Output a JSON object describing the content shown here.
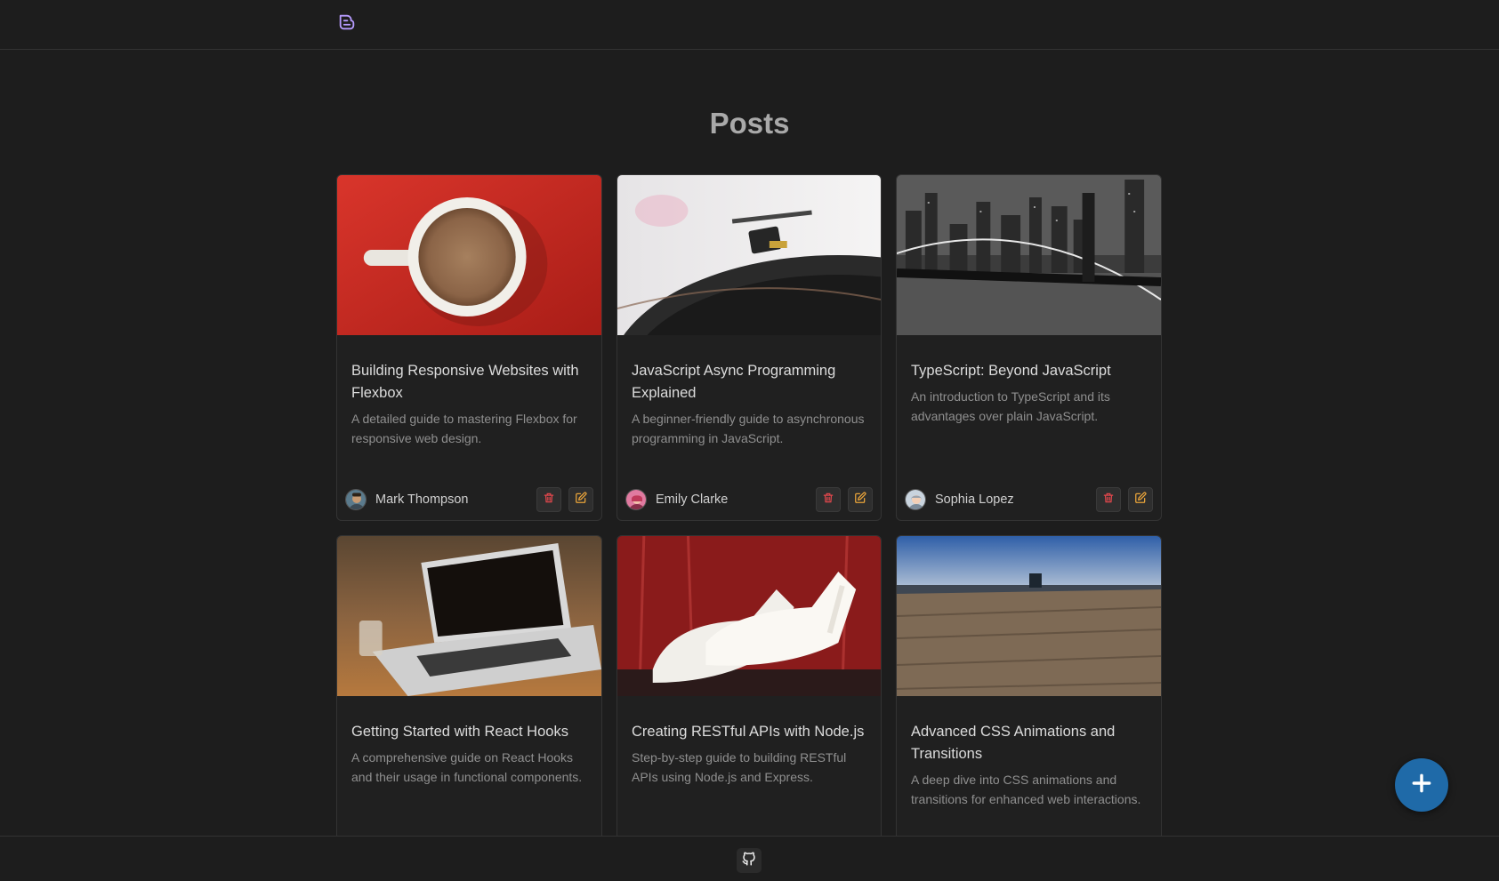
{
  "header": {
    "logo_icon": "blog-icon"
  },
  "page": {
    "title": "Posts"
  },
  "posts": [
    {
      "title": "Building Responsive Websites with Flexbox",
      "description": "A detailed guide to mastering Flexbox for responsive web design.",
      "author": "Mark Thompson",
      "image": "coffee-cup-photo"
    },
    {
      "title": "JavaScript Async Programming Explained",
      "description": "A beginner-friendly guide to asynchronous programming in JavaScript.",
      "author": "Emily Clarke",
      "image": "record-player-photo"
    },
    {
      "title": "TypeScript: Beyond JavaScript",
      "description": "An introduction to TypeScript and its advantages over plain JavaScript.",
      "author": "Sophia Lopez",
      "image": "city-bridge-photo"
    },
    {
      "title": "Getting Started with React Hooks",
      "description": "A comprehensive guide on React Hooks and their usage in functional components.",
      "author": "",
      "image": "laptop-photo"
    },
    {
      "title": "Creating RESTful APIs with Node.js",
      "description": "Step-by-step guide to building RESTful APIs using Node.js and Express.",
      "author": "",
      "image": "white-heels-photo"
    },
    {
      "title": "Advanced CSS Animations and Transitions",
      "description": "A deep dive into CSS animations and transitions for enhanced web interactions.",
      "author": "",
      "image": "wooden-pier-photo"
    }
  ],
  "actions": {
    "add_icon": "plus-icon",
    "delete_icon": "trash-icon",
    "edit_icon": "edit-icon"
  },
  "footer": {
    "icon": "github-icon"
  },
  "colors": {
    "background": "#1d1d1d",
    "fab": "#1f6aa8",
    "delete": "#e0474c",
    "edit": "#e8a33a",
    "logo": "#b79cff"
  }
}
